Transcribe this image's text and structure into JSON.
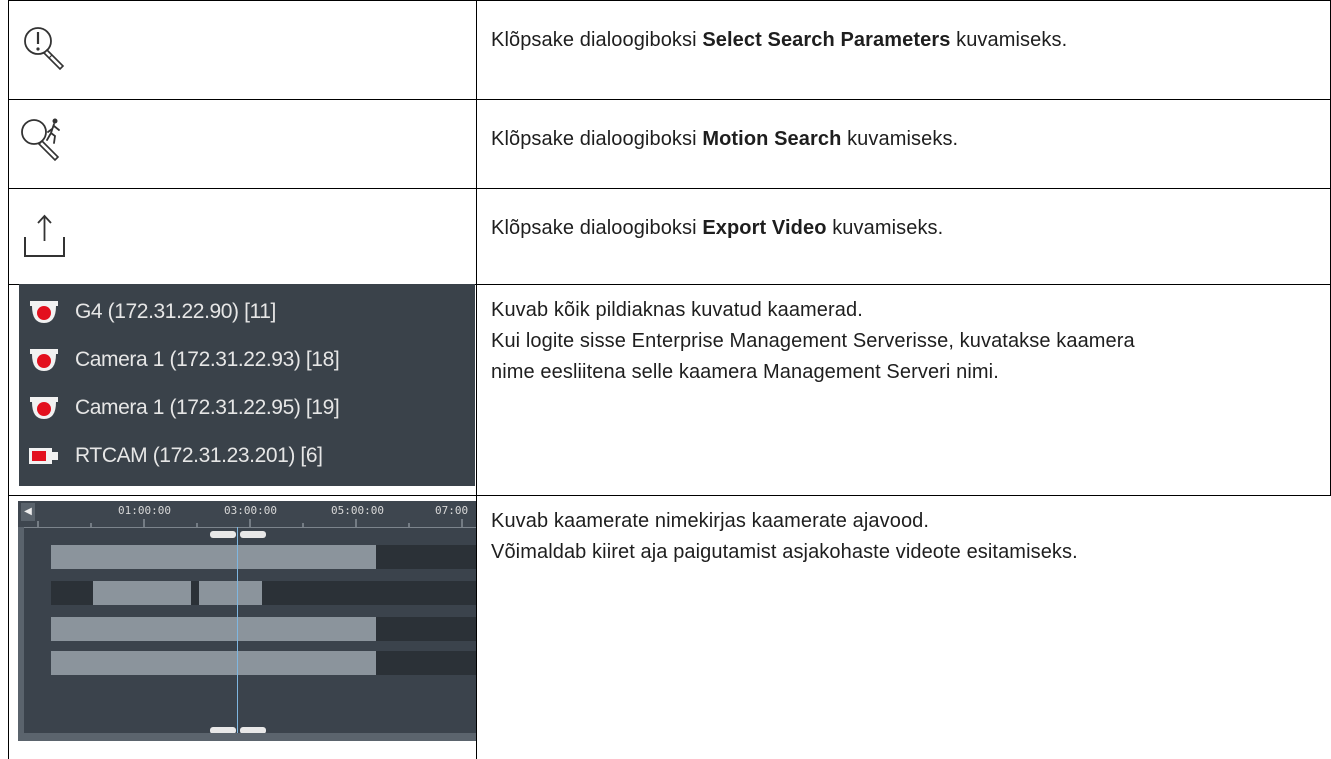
{
  "rows": [
    {
      "icon": "search-parameters-icon",
      "text_before": "Klõpsake dialoogiboksi ",
      "bold": "Select Search Parameters",
      "text_after": " kuvamiseks."
    },
    {
      "icon": "motion-search-icon",
      "text_before": "Klõpsake dialoogiboksi ",
      "bold": "Motion Search",
      "text_after": " kuvamiseks."
    },
    {
      "icon": "export-video-icon",
      "text_before": "Klõpsake dialoogiboksi ",
      "bold": "Export Video",
      "text_after": " kuvamiseks."
    },
    {
      "lines": [
        "Kuvab kõik pildiaknas kuvatud kaamerad.",
        "Kui logite sisse Enterprise Management Serverisse, kuvatakse kaamera",
        "nime eesliitena selle kaamera Management Serveri nimi."
      ]
    },
    {
      "lines": [
        "Kuvab kaamerate nimekirjas kaamerate ajavood.",
        "Võimaldab kiiret aja paigutamist asjakohaste videote esitamiseks."
      ]
    }
  ],
  "camera_list": [
    {
      "name": "G4 (172.31.22.90) [11]",
      "icon": "dome-camera-icon"
    },
    {
      "name": "Camera 1 (172.31.22.93) [18]",
      "icon": "dome-camera-icon"
    },
    {
      "name": "Camera 1 (172.31.22.95) [19]",
      "icon": "dome-camera-icon"
    },
    {
      "name": "RTCAM (172.31.23.201) [6]",
      "icon": "box-camera-icon"
    }
  ],
  "timeline": {
    "ticks": [
      "01:00:00",
      "03:00:00",
      "05:00:00",
      "07:00"
    ],
    "colors": {
      "recorded": "#8b949c",
      "empty": "#2b3137",
      "cursor": "#7fb6e0",
      "panel": "#3b434c"
    }
  }
}
